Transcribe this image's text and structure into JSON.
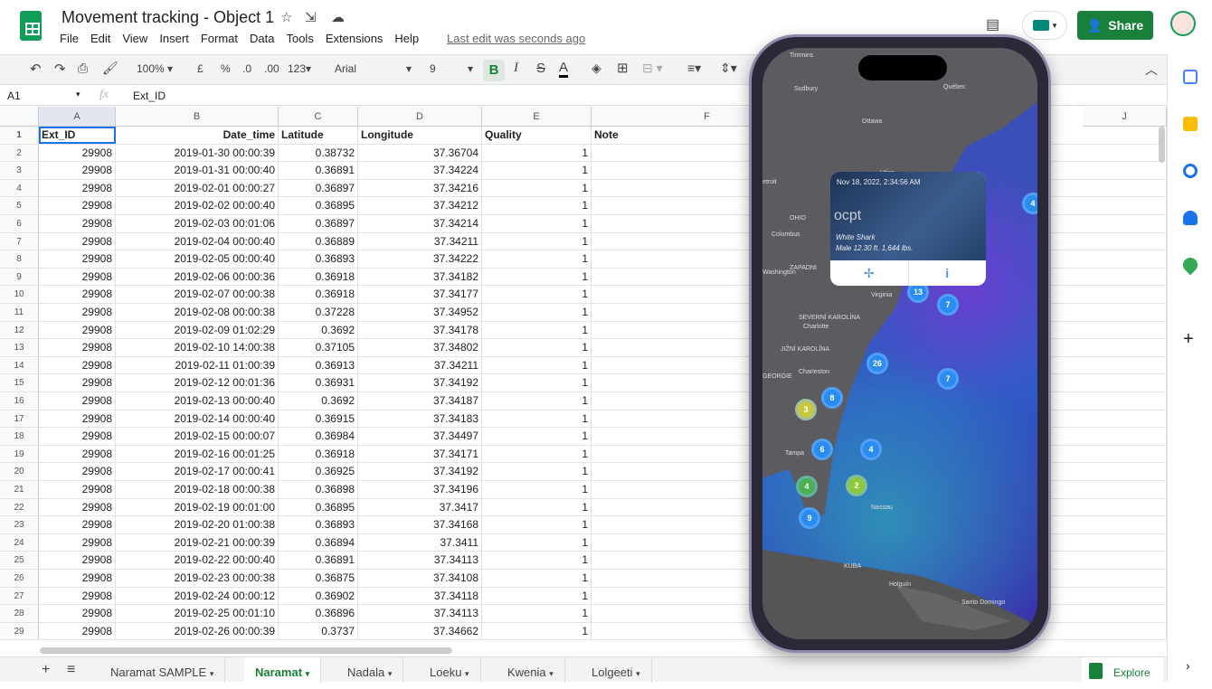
{
  "app": {
    "title": "Movement tracking - Object 1",
    "menu": [
      "File",
      "Edit",
      "View",
      "Insert",
      "Format",
      "Data",
      "Tools",
      "Extensions",
      "Help"
    ],
    "last_edit": "Last edit was seconds ago",
    "share": "Share"
  },
  "toolbar": {
    "zoom": "100%",
    "currency": "£",
    "percent": "%",
    "dec_less": ".0",
    "dec_more": ".00",
    "format": "123",
    "font": "Arial",
    "size": "9",
    "bold": "B",
    "italic": "I",
    "strike": "S",
    "textcolor": "A"
  },
  "formula": {
    "cell_ref": "A1",
    "fx": "fx",
    "value": "Ext_ID"
  },
  "columns": [
    "A",
    "B",
    "C",
    "D",
    "E",
    "F",
    "J"
  ],
  "headers": [
    "Ext_ID",
    "Date_time",
    "Latitude",
    "Longitude",
    "Quality",
    "Note"
  ],
  "rows": [
    [
      "29908",
      "2019-01-30 00:00:39",
      "0.38732",
      "37.36704",
      "1"
    ],
    [
      "29908",
      "2019-01-31 00:00:40",
      "0.36891",
      "37.34224",
      "1"
    ],
    [
      "29908",
      "2019-02-01 00:00:27",
      "0.36897",
      "37.34216",
      "1"
    ],
    [
      "29908",
      "2019-02-02 00:00:40",
      "0.36895",
      "37.34212",
      "1"
    ],
    [
      "29908",
      "2019-02-03 00:01:06",
      "0.36897",
      "37.34214",
      "1"
    ],
    [
      "29908",
      "2019-02-04 00:00:40",
      "0.36889",
      "37.34211",
      "1"
    ],
    [
      "29908",
      "2019-02-05 00:00:40",
      "0.36893",
      "37.34222",
      "1"
    ],
    [
      "29908",
      "2019-02-06 00:00:36",
      "0.36918",
      "37.34182",
      "1"
    ],
    [
      "29908",
      "2019-02-07 00:00:38",
      "0.36918",
      "37.34177",
      "1"
    ],
    [
      "29908",
      "2019-02-08 00:00:38",
      "0.37228",
      "37.34952",
      "1"
    ],
    [
      "29908",
      "2019-02-09 01:02:29",
      "0.3692",
      "37.34178",
      "1"
    ],
    [
      "29908",
      "2019-02-10 14:00:38",
      "0.37105",
      "37.34802",
      "1"
    ],
    [
      "29908",
      "2019-02-11 01:00:39",
      "0.36913",
      "37.34211",
      "1"
    ],
    [
      "29908",
      "2019-02-12 00:01:36",
      "0.36931",
      "37.34192",
      "1"
    ],
    [
      "29908",
      "2019-02-13 00:00:40",
      "0.3692",
      "37.34187",
      "1"
    ],
    [
      "29908",
      "2019-02-14 00:00:40",
      "0.36915",
      "37.34183",
      "1"
    ],
    [
      "29908",
      "2019-02-15 00:00:07",
      "0.36984",
      "37.34497",
      "1"
    ],
    [
      "29908",
      "2019-02-16 00:01:25",
      "0.36918",
      "37.34171",
      "1"
    ],
    [
      "29908",
      "2019-02-17 00:00:41",
      "0.36925",
      "37.34192",
      "1"
    ],
    [
      "29908",
      "2019-02-18 00:00:38",
      "0.36898",
      "37.34196",
      "1"
    ],
    [
      "29908",
      "2019-02-19 00:01:00",
      "0.36895",
      "37.3417",
      "1"
    ],
    [
      "29908",
      "2019-02-20 01:00:38",
      "0.36893",
      "37.34168",
      "1"
    ],
    [
      "29908",
      "2019-02-21 00:00:39",
      "0.36894",
      "37.3411",
      "1"
    ],
    [
      "29908",
      "2019-02-22 00:00:40",
      "0.36891",
      "37.34113",
      "1"
    ],
    [
      "29908",
      "2019-02-23 00:00:38",
      "0.36875",
      "37.34108",
      "1"
    ],
    [
      "29908",
      "2019-02-24 00:00:12",
      "0.36902",
      "37.34118",
      "1"
    ],
    [
      "29908",
      "2019-02-25 00:01:10",
      "0.36896",
      "37.34113",
      "1"
    ],
    [
      "29908",
      "2019-02-26 00:00:39",
      "0.3737",
      "37.34662",
      "1"
    ]
  ],
  "sheets": {
    "add": "+",
    "list": "≡",
    "tabs": [
      "Naramat SAMPLE",
      "Naramat",
      "Nadala",
      "Loeku",
      "Kwenia",
      "Lolgeeti"
    ],
    "active": "Naramat",
    "explore": "Explore"
  },
  "phone": {
    "popup": {
      "timestamp": "Nov 18, 2022, 2:34:56 AM",
      "name": "ocpt",
      "species": "White Shark",
      "details": "Male 12.30 ft. 1,644 lbs."
    },
    "places": [
      "Timmins",
      "Sudbury",
      "Québec",
      "Ottawa",
      "Detroit",
      "Utica",
      "OHIO",
      "Columbus",
      "ZAPADNI",
      "Washington",
      "Virginia",
      "SEVERNÍ KAROLÍNA",
      "Charlotte",
      "JIŽNÍ KAROLÍNA",
      "Charleston",
      "GEORGIE",
      "Tampa",
      "Nassau",
      "KUBA",
      "Holguín",
      "Santo Domingo"
    ],
    "clusters": [
      "13",
      "7",
      "26",
      "7",
      "8",
      "3",
      "6",
      "4",
      "2",
      "4",
      "9",
      "4"
    ]
  },
  "colors": {
    "brand": "#188038",
    "accent": "#1a73e8"
  }
}
